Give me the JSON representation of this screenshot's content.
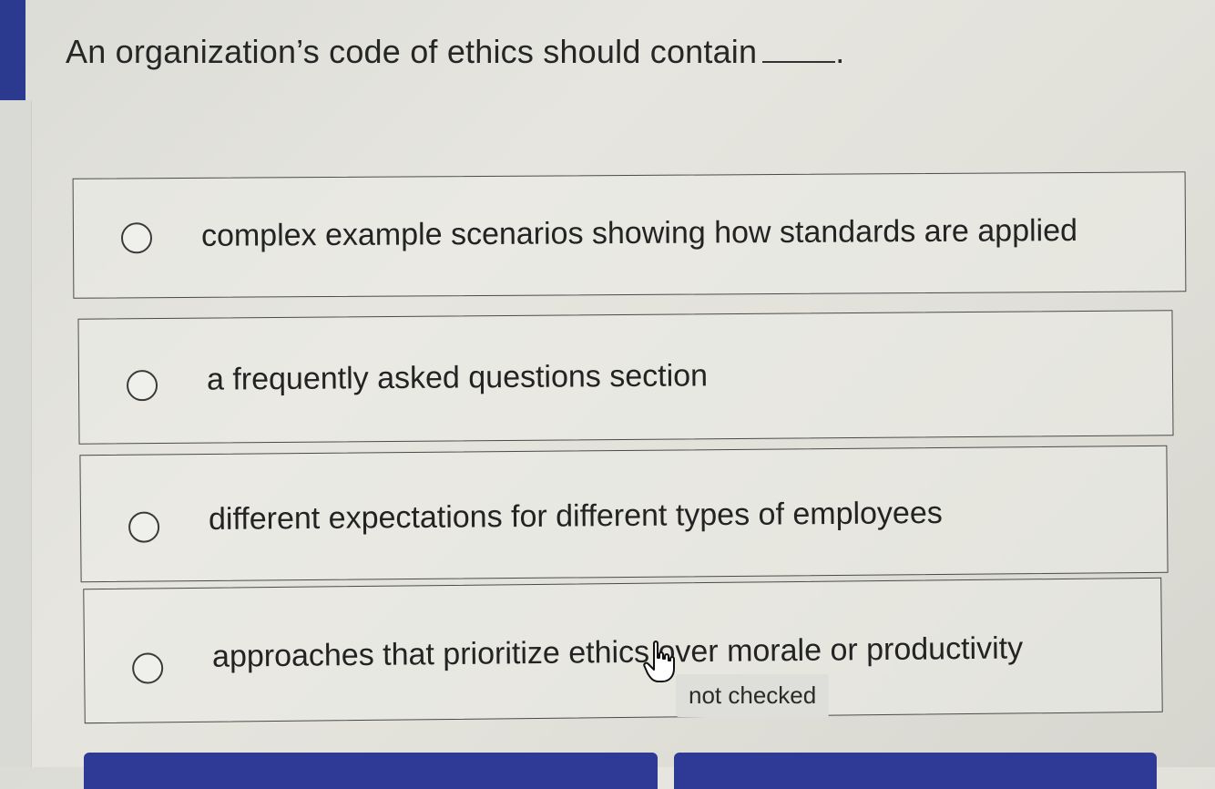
{
  "question": {
    "text": "An organization’s code of ethics should contain",
    "terminal_punctuation": "."
  },
  "options": [
    {
      "label": "complex example scenarios showing how standards are applied",
      "selected": false
    },
    {
      "label": "a frequently asked questions section",
      "selected": false
    },
    {
      "label": "different expectations for different types of employees",
      "selected": false
    },
    {
      "label": "approaches that prioritize ethics over morale or productivity",
      "selected": false
    }
  ],
  "status": {
    "text": "not checked"
  },
  "cursor": {
    "icon": "hand-pointer-icon"
  },
  "colors": {
    "accent": "#2b3a8f",
    "button": "#2f3a96"
  }
}
